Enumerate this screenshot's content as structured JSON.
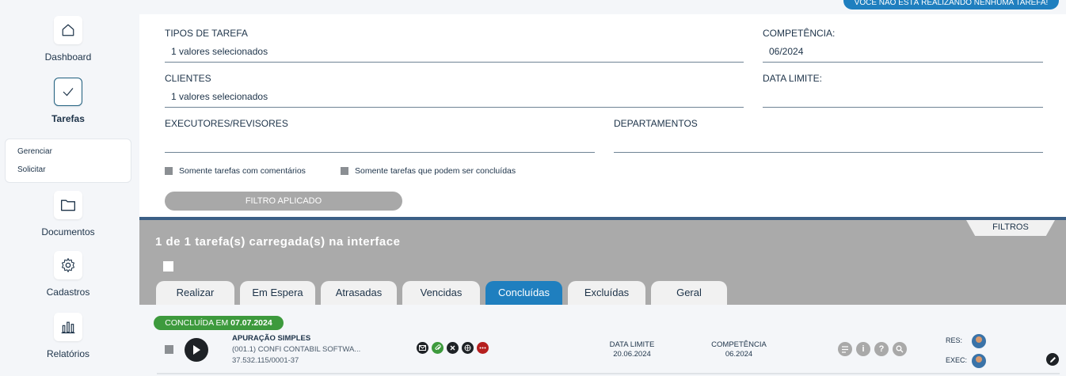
{
  "top_badge": "VOCÊ NÃO ESTÁ REALIZANDO NENHUMA TAREFA!",
  "sidebar": {
    "items": [
      {
        "label": "Dashboard",
        "icon": "home-icon"
      },
      {
        "label": "Tarefas",
        "icon": "check-icon",
        "active": true
      },
      {
        "label": "Documentos",
        "icon": "folder-icon"
      },
      {
        "label": "Cadastros",
        "icon": "gear-icon"
      },
      {
        "label": "Relatórios",
        "icon": "bar-chart-icon"
      }
    ],
    "submenu": [
      "Gerenciar",
      "Solicitar"
    ]
  },
  "filters": {
    "tipos_label": "TIPOS DE TAREFA",
    "tipos_value": "1 valores selecionados",
    "competencia_label": "COMPETÊNCIA:",
    "competencia_value": "06/2024",
    "clientes_label": "CLIENTES",
    "clientes_value": "1 valores selecionados",
    "data_limite_label": "DATA LIMITE:",
    "data_limite_value": "",
    "executores_label": "EXECUTORES/REVISORES",
    "executores_value": "",
    "departamentos_label": "DEPARTAMENTOS",
    "departamentos_value": "",
    "check_comments": "Somente tarefas com comentários",
    "check_concluable": "Somente tarefas que podem ser concluídas",
    "applied_button": "FILTRO APLICADO"
  },
  "tasks": {
    "filtros_tab": "FILTROS",
    "loaded_count": "1 de 1 tarefa(s) carregada(s) na interface",
    "tabs": [
      "Realizar",
      "Em Espera",
      "Atrasadas",
      "Vencidas",
      "Concluídas",
      "Excluídas",
      "Geral"
    ],
    "active_tab": "Concluídas"
  },
  "task_row": {
    "status_prefix": "CONCLUÍDA EM",
    "status_date": "07.07.2024",
    "title": "APURAÇÃO SIMPLES",
    "client": "(001.1) CONFI CONTABIL SOFTWA...",
    "doc": "37.532.115/0001-37",
    "data_limite_label": "DATA LIMITE",
    "data_limite_value": "20.06.2024",
    "competencia_label": "COMPETÊNCIA",
    "competencia_value": "06.2024",
    "res_label": "RES:",
    "exec_label": "EXEC:",
    "colors": {
      "status": "#3d9a3d",
      "accent": "#1f7fbf"
    }
  }
}
